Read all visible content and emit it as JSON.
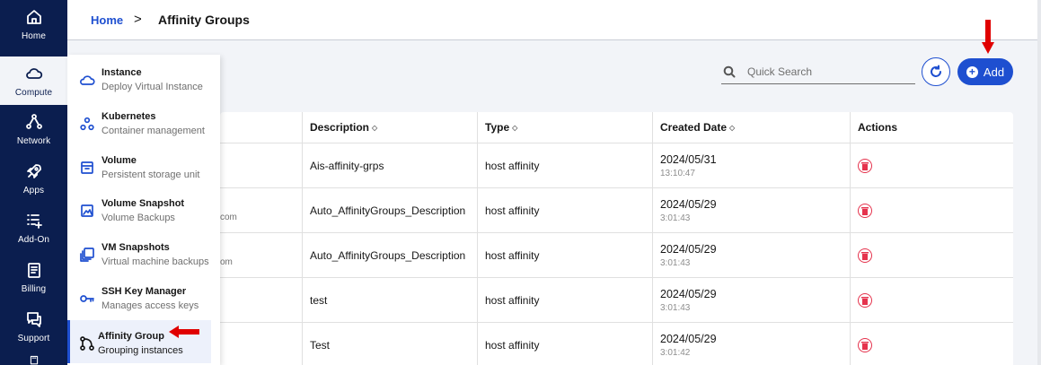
{
  "rail": {
    "items": [
      {
        "label": "Home",
        "icon": "home-icon"
      },
      {
        "label": "Compute",
        "icon": "cloud-icon",
        "active": true
      },
      {
        "label": "Network",
        "icon": "network-icon"
      },
      {
        "label": "Apps",
        "icon": "rocket-icon"
      },
      {
        "label": "Add-On",
        "icon": "add-on-icon"
      },
      {
        "label": "Billing",
        "icon": "billing-icon"
      },
      {
        "label": "Support",
        "icon": "chat-icon"
      }
    ]
  },
  "breadcrumb": {
    "home": "Home",
    "separator": ">",
    "current": "Affinity Groups"
  },
  "toolbar": {
    "search_placeholder": "Quick Search",
    "add_label": "Add"
  },
  "table": {
    "columns": {
      "description": "Description",
      "type": "Type",
      "created": "Created Date",
      "actions": "Actions"
    },
    "rows": [
      {
        "name_fragment": "",
        "description": "Ais-affinity-grps",
        "type": "host affinity",
        "date": "2024/05/31",
        "time": "13:10:47"
      },
      {
        "name_fragment": "com",
        "description": "Auto_AffinityGroups_Description",
        "type": "host affinity",
        "date": "2024/05/29",
        "time": "3:01:43"
      },
      {
        "name_fragment": "om",
        "description": "Auto_AffinityGroups_Description",
        "type": "host affinity",
        "date": "2024/05/29",
        "time": "3:01:43"
      },
      {
        "name_fragment": "",
        "description": "test",
        "type": "host affinity",
        "date": "2024/05/29",
        "time": "3:01:43"
      },
      {
        "name_fragment": "",
        "description": "Test",
        "type": "host affinity",
        "date": "2024/05/29",
        "time": "3:01:42"
      }
    ]
  },
  "menu": {
    "items": [
      {
        "title": "Instance",
        "sub": "Deploy Virtual Instance",
        "icon": "cloud-icon"
      },
      {
        "title": "Kubernetes",
        "sub": "Container management",
        "icon": "kubernetes-icon"
      },
      {
        "title": "Volume",
        "sub": "Persistent storage unit",
        "icon": "volume-icon"
      },
      {
        "title": "Volume Snapshot",
        "sub": "Volume Backups",
        "icon": "snapshot-icon"
      },
      {
        "title": "VM Snapshots",
        "sub": "Virtual machine backups",
        "icon": "vm-snapshot-icon"
      },
      {
        "title": "SSH Key Manager",
        "sub": "Manages access keys",
        "icon": "key-icon"
      },
      {
        "title": "Affinity Group",
        "sub": "Grouping instances",
        "icon": "affinity-group-icon",
        "active": true
      }
    ]
  },
  "colors": {
    "rail": "#0b1e4f",
    "accent": "#1e4fd0",
    "danger": "#e5334d",
    "annotation_arrow": "#e00000"
  }
}
